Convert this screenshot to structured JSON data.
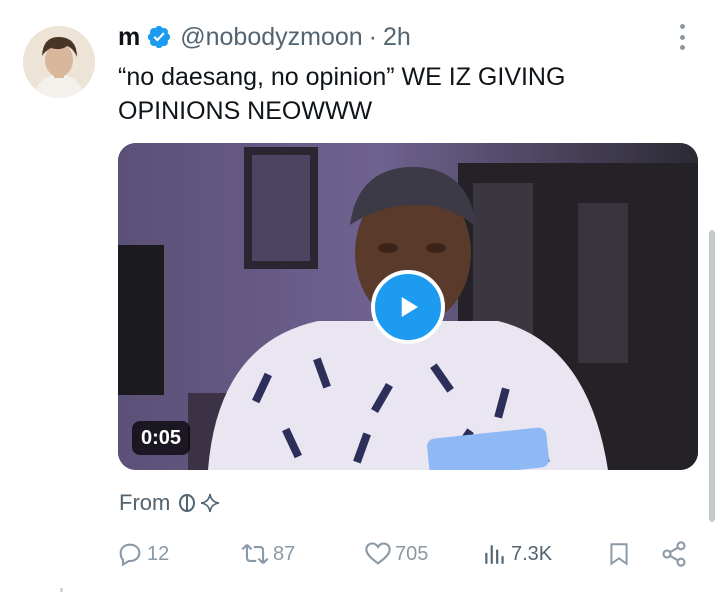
{
  "author": {
    "name": "m",
    "handle": "@nobodyzmoon",
    "separator": "·",
    "time": "2h",
    "verified": true
  },
  "tweet": {
    "text": "“no daesang, no opinion” WE IZ GIVING OPINIONS NEOWWW"
  },
  "media": {
    "type": "video",
    "duration": "0:05",
    "play_icon": "play-icon"
  },
  "source": {
    "label": "From",
    "icons": [
      "threads-logo-icon",
      "sparkle-icon"
    ]
  },
  "actions": {
    "reply": {
      "icon": "reply-icon",
      "count": "12"
    },
    "repost": {
      "icon": "repost-icon",
      "count": "87"
    },
    "like": {
      "icon": "heart-icon",
      "count": "705"
    },
    "views": {
      "icon": "views-icon",
      "count": "7.3K"
    },
    "bookmark": {
      "icon": "bookmark-icon"
    },
    "share": {
      "icon": "share-icon"
    }
  },
  "colors": {
    "accent": "#1d9bf0",
    "text": "#0f1419",
    "muted": "#536471",
    "icon_muted": "#8b98a5"
  }
}
